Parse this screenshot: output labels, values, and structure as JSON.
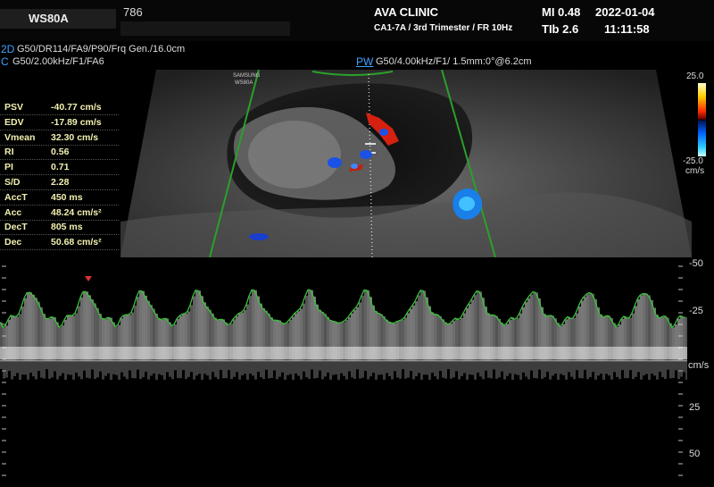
{
  "header": {
    "model": "WS80A",
    "patient_id": "786",
    "clinic": "AVA CLINIC",
    "preset": "CA1-7A / 3rd Trimester / FR 10Hz",
    "mi": "MI  0.48",
    "tib": "TIb 2.6",
    "date": "2022-01-04",
    "time": "11:11:58"
  },
  "modes": {
    "m2d_key": "2D",
    "m2d_val": "G50/DR114/FA9/P90/Frq Gen./16.0cm",
    "mc_key": "C",
    "mc_val": "G50/2.00kHz/F1/FA6",
    "pw_key": "PW",
    "pw_val": "G50/4.00kHz/F1/ 1.5mm:0°@6.2cm"
  },
  "image": {
    "watermark_line1": "SAMSUNG",
    "watermark_line2": "WS80A"
  },
  "measurements": [
    {
      "label": "PSV",
      "value": "-40.77 cm/s"
    },
    {
      "label": "EDV",
      "value": "-17.89 cm/s"
    },
    {
      "label": "Vmean",
      "value": "32.30 cm/s"
    },
    {
      "label": "RI",
      "value": "0.56"
    },
    {
      "label": "PI",
      "value": "0.71"
    },
    {
      "label": "S/D",
      "value": "2.28"
    },
    {
      "label": "AccT",
      "value": "450     ms"
    },
    {
      "label": "Acc",
      "value": "48.24 cm/s²"
    },
    {
      "label": "DecT",
      "value": "805     ms"
    },
    {
      "label": "Dec",
      "value": "50.68 cm/s²"
    }
  ],
  "color_scale": {
    "top": "25.0",
    "bottom": "-25.0",
    "unit": "cm/s"
  },
  "spectral_scale": {
    "v50a": "-50",
    "v25a": "-25",
    "unit": "cm/s",
    "v25b": "25",
    "v50b": "50"
  },
  "colors": {
    "accent_blue": "#3da3ff",
    "measure_text": "#f2f0b0",
    "envelope": "#3ac23a"
  }
}
